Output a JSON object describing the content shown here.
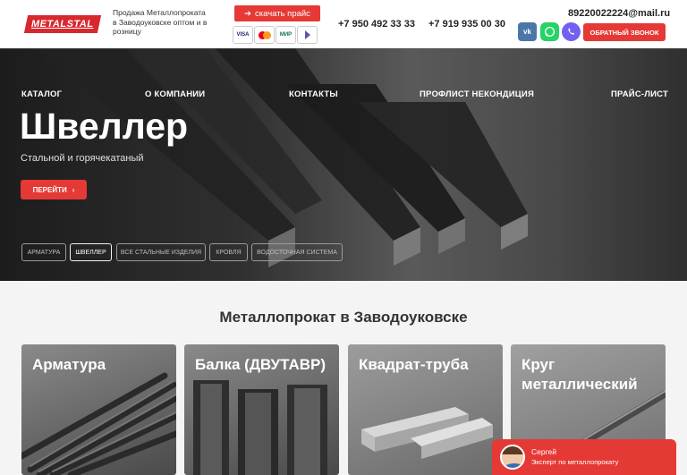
{
  "header": {
    "logo_text": "METALSTAL",
    "tagline": "Продажа Металлопроката в Заводоуковске оптом и в розницу",
    "download_label": "скачать прайс",
    "payments": [
      "VISA",
      "MasterCard",
      "МИР",
      "СБП"
    ],
    "phones": [
      "+7 950 492 33 33",
      "+7 919 935 00 30"
    ],
    "email": "89220022224@mail.ru",
    "socials": [
      "vk",
      "whatsapp",
      "viber"
    ],
    "callback_label": "ОБРАТНЫЙ ЗВОНОК"
  },
  "nav": [
    "КАТАЛОГ",
    "О КОМПАНИИ",
    "КОНТАКТЫ",
    "ПРОФЛИСТ НЕКОНДИЦИЯ",
    "ПРАЙС-ЛИСТ"
  ],
  "hero": {
    "title": "Швеллер",
    "subtitle": "Стальной и горячекатаный",
    "button_label": "ПЕРЕЙТИ",
    "chips": [
      "АРМАТУРА",
      "ШВЕЛЛЕР",
      "ВСЕ СТАЛЬНЫЕ ИЗДЕЛИЯ",
      "КРОВЛЯ",
      "ВОДОСТОЧНАЯ СИСТЕМА"
    ],
    "active_chip": "ШВЕЛЛЕР"
  },
  "catalog": {
    "title": "Металлопрокат в Заводоуковске",
    "cards": [
      "Арматура",
      "Балка (ДВУТАВР)",
      "Квадрат-труба",
      "Круг металлический"
    ]
  },
  "chat": {
    "name": "Сергей",
    "role": "Эксперт по металлопрокату"
  },
  "colors": {
    "accent": "#e53935",
    "header_bg": "#ffffff",
    "page_bg": "#f4f4f4"
  }
}
